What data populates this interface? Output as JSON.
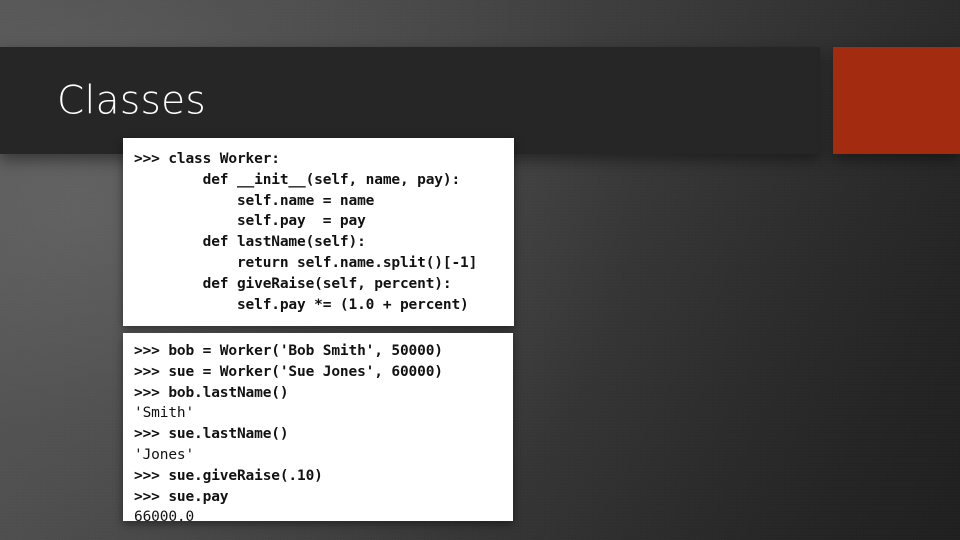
{
  "slide": {
    "title": "Classes",
    "accent_color": "#a32c10",
    "title_band_color": "#262626",
    "background_color": "#3b3b3b"
  },
  "code_block_class": {
    "name": "python-class-definition",
    "lines": [
      {
        "text": ">>> class Worker:",
        "kind": "input"
      },
      {
        "text": "        def __init__(self, name, pay):",
        "kind": "input"
      },
      {
        "text": "            self.name = name",
        "kind": "input"
      },
      {
        "text": "            self.pay  = pay",
        "kind": "input"
      },
      {
        "text": "        def lastName(self):",
        "kind": "input"
      },
      {
        "text": "            return self.name.split()[-1]",
        "kind": "input"
      },
      {
        "text": "        def giveRaise(self, percent):",
        "kind": "input"
      },
      {
        "text": "            self.pay *= (1.0 + percent)",
        "kind": "input"
      }
    ]
  },
  "code_block_session": {
    "name": "python-interactive-session",
    "lines": [
      {
        "text": ">>> bob = Worker('Bob Smith', 50000)",
        "kind": "input"
      },
      {
        "text": ">>> sue = Worker('Sue Jones', 60000)",
        "kind": "input"
      },
      {
        "text": ">>> bob.lastName()",
        "kind": "input"
      },
      {
        "text": "'Smith'",
        "kind": "output"
      },
      {
        "text": ">>> sue.lastName()",
        "kind": "input"
      },
      {
        "text": "'Jones'",
        "kind": "output"
      },
      {
        "text": ">>> sue.giveRaise(.10)",
        "kind": "input"
      },
      {
        "text": ">>> sue.pay",
        "kind": "input"
      },
      {
        "text": "66000.0",
        "kind": "output"
      }
    ]
  }
}
